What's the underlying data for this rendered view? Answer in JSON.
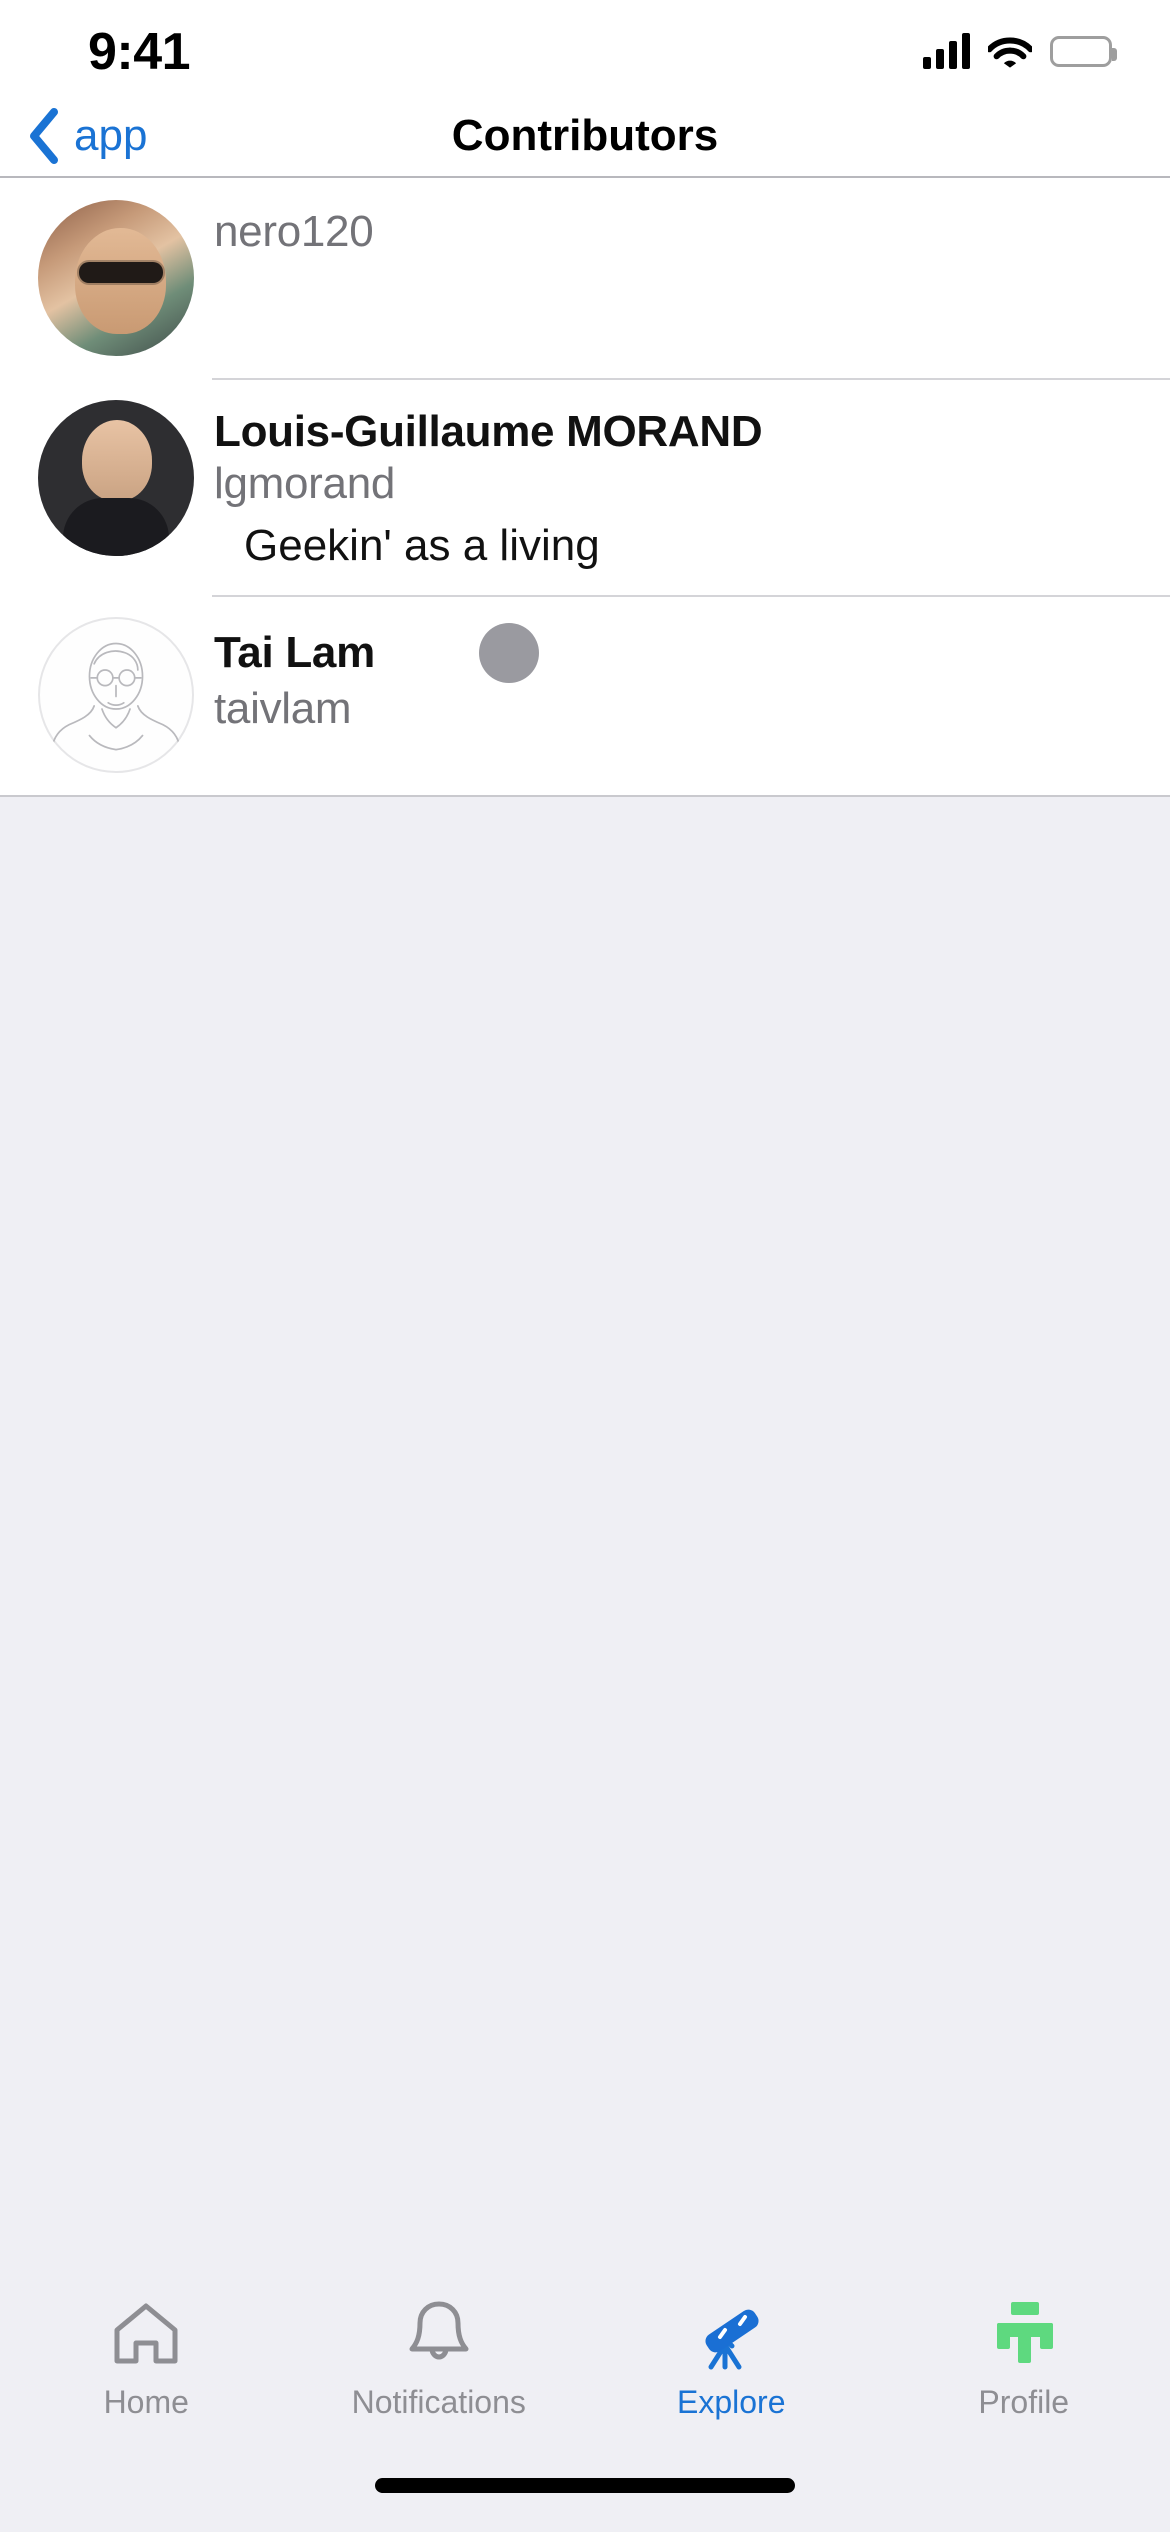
{
  "status_bar": {
    "time": "9:41",
    "cellular_icon": "cellular-signal-icon",
    "wifi_icon": "wifi-icon",
    "battery_icon": "battery-icon"
  },
  "nav_bar": {
    "back_label": "app",
    "back_icon": "chevron-left-icon",
    "title": "Contributors"
  },
  "contributors": [
    {
      "name": "",
      "username": "nero120",
      "bio": "",
      "avatar": "photo-avatar-sunglasses",
      "has_loading_dot": false
    },
    {
      "name": "Louis-Guillaume MORAND",
      "username": "lgmorand",
      "bio": "Geekin' as a living",
      "avatar": "photo-avatar-portrait",
      "has_loading_dot": false
    },
    {
      "name": "Tai Lam",
      "username": "taivlam",
      "bio": "",
      "avatar": "sketch-avatar-portrait",
      "has_loading_dot": true
    }
  ],
  "tab_bar": {
    "items": [
      {
        "label": "Home",
        "icon": "home-icon",
        "active": false
      },
      {
        "label": "Notifications",
        "icon": "bell-icon",
        "active": false
      },
      {
        "label": "Explore",
        "icon": "telescope-icon",
        "active": true
      },
      {
        "label": "Profile",
        "icon": "profile-icon",
        "active": false
      }
    ]
  },
  "colors": {
    "accent_blue": "#1a73d4",
    "profile_green": "#5ed97f",
    "inactive_gray": "#8e8e93",
    "page_background": "#EFEFF4",
    "list_background": "#FFFFFF",
    "separator": "#d4d4d8",
    "loading_dot": "#9a9aa0"
  }
}
